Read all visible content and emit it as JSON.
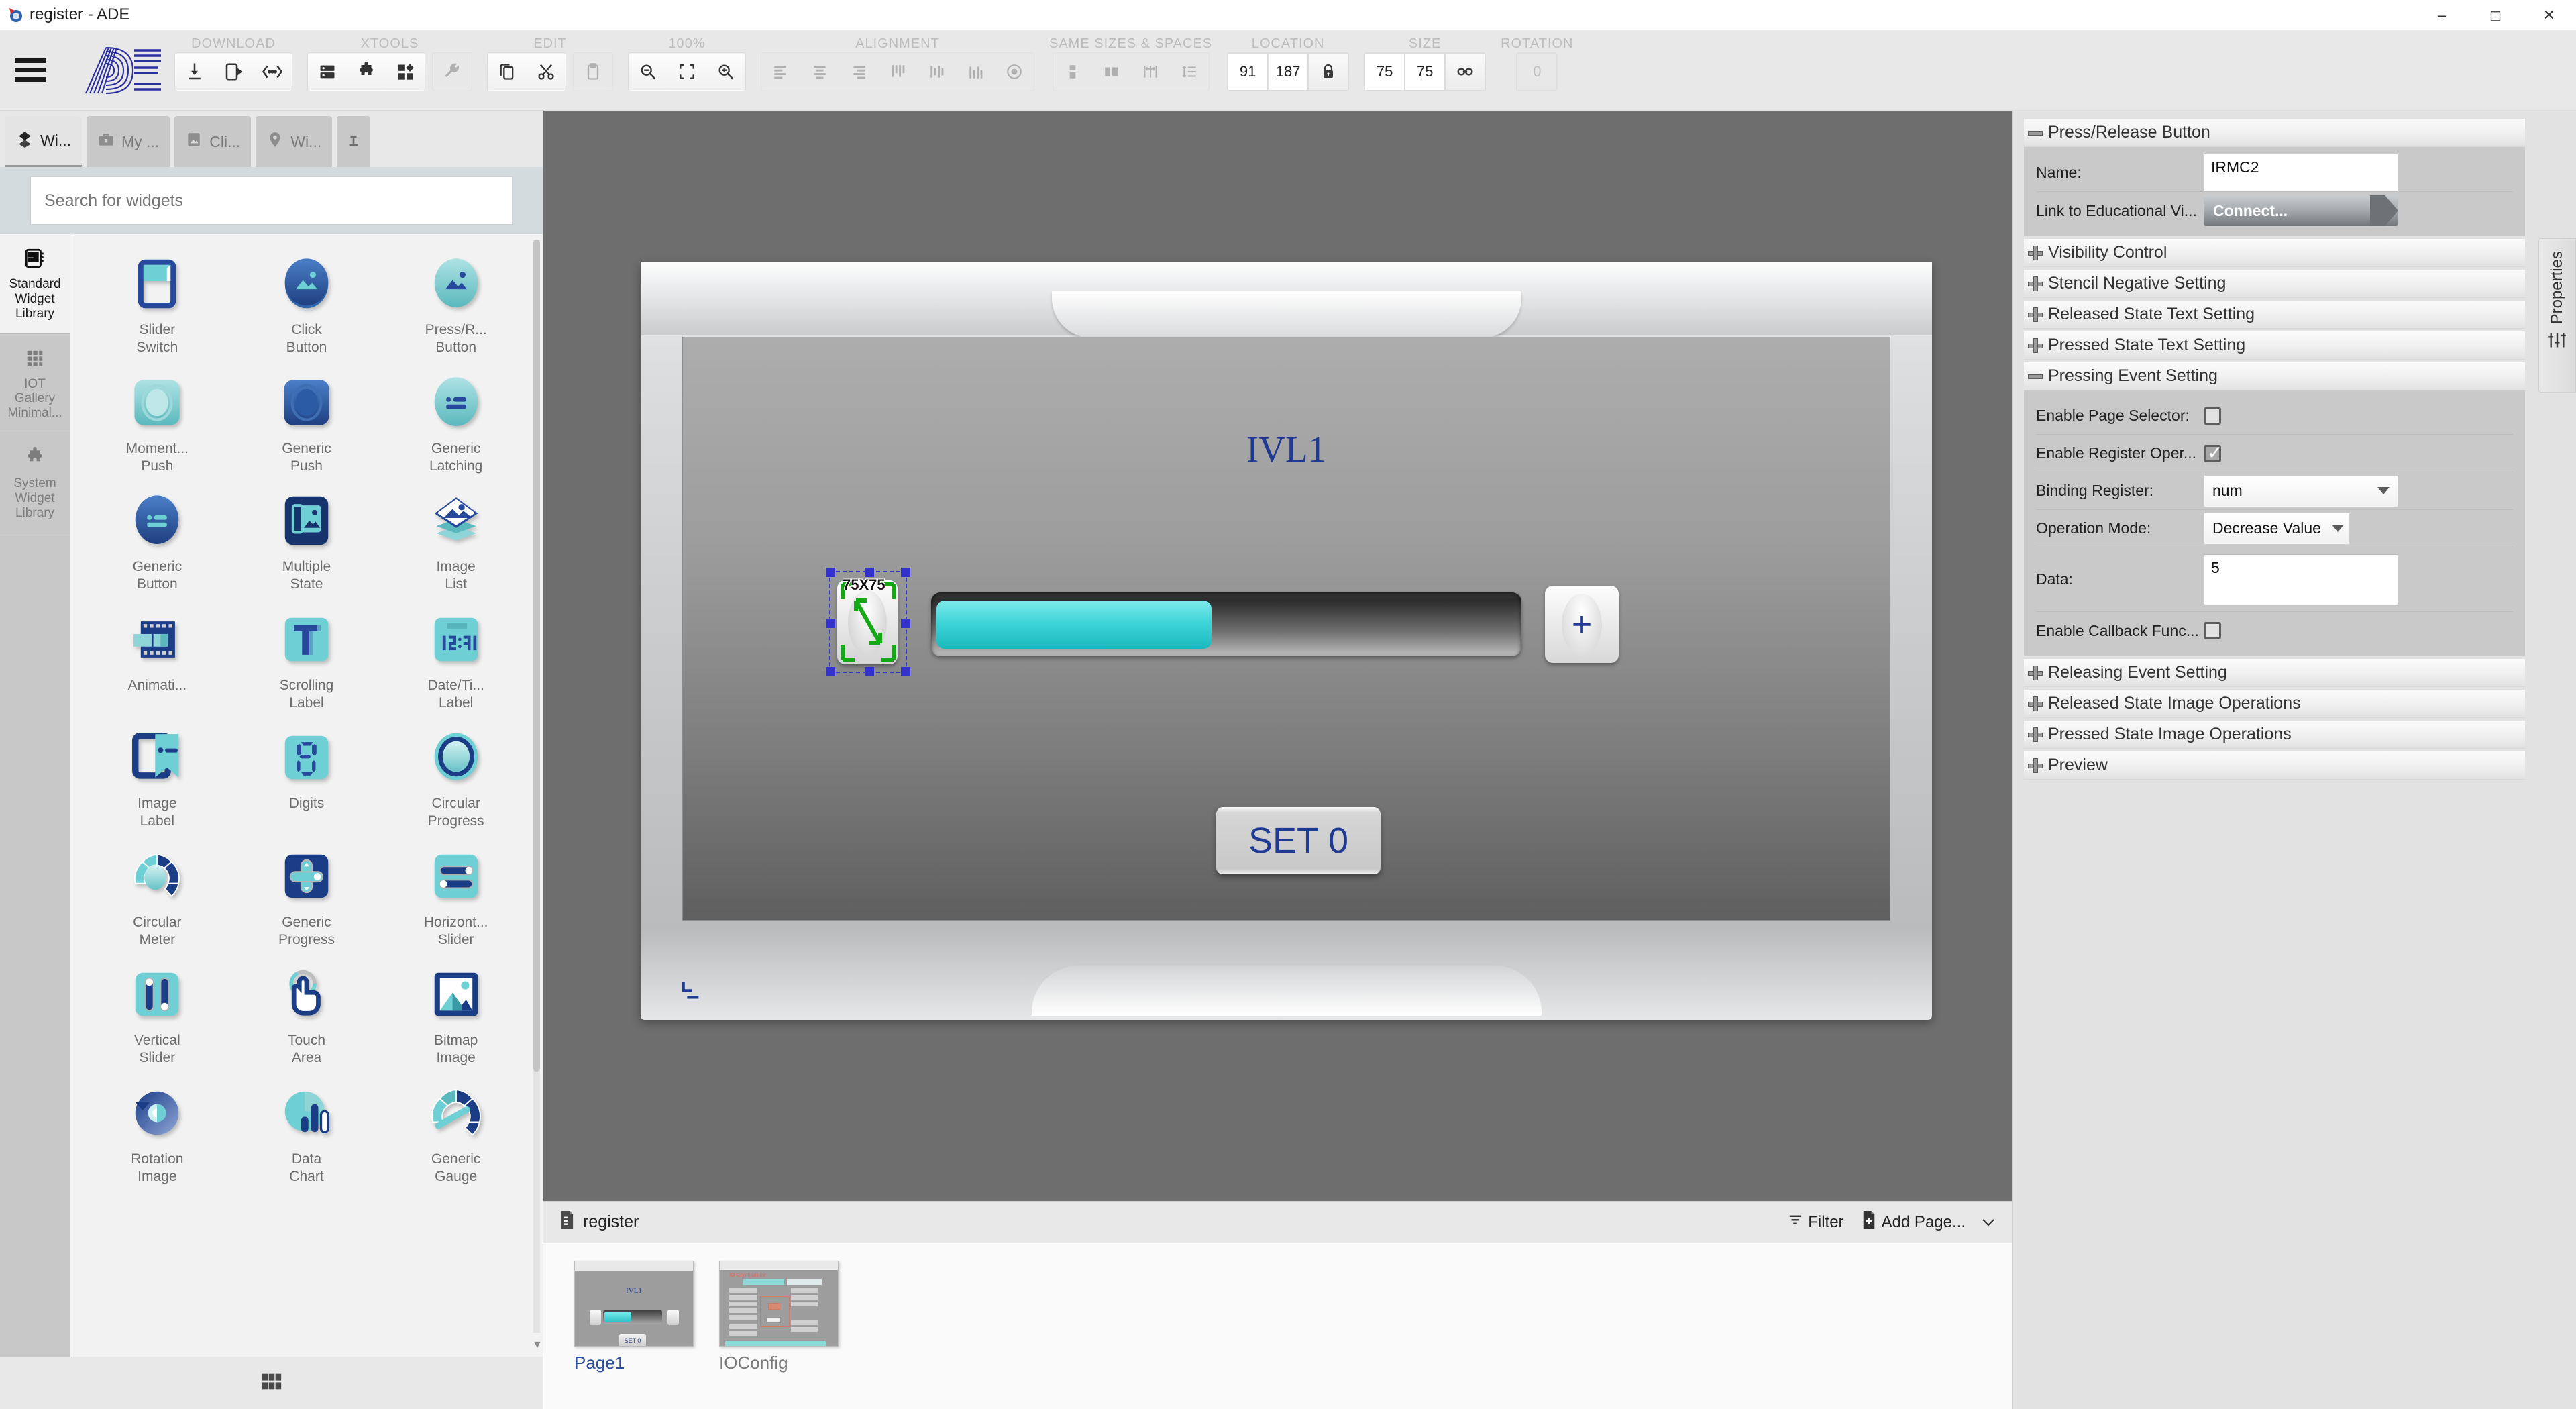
{
  "window": {
    "title": "register - ADE",
    "icon": "app-icon",
    "controls": [
      "minimize",
      "maximize",
      "close"
    ]
  },
  "ribbon": {
    "logo_text": "ADE",
    "groups": [
      {
        "label": "DOWNLOAD",
        "buttons": [
          {
            "name": "download-icon",
            "enabled": true
          },
          {
            "name": "export-device-icon",
            "enabled": true
          },
          {
            "name": "code-brackets-icon",
            "enabled": true
          }
        ]
      },
      {
        "label": "XTOOLS",
        "buttons": [
          {
            "name": "server-icon",
            "enabled": true
          },
          {
            "name": "puzzle-icon",
            "enabled": true
          },
          {
            "name": "components-icon",
            "enabled": true
          },
          {
            "name": "wrench-icon",
            "enabled": false
          }
        ]
      },
      {
        "label": "EDIT",
        "buttons": [
          {
            "name": "copy-icon",
            "enabled": true
          },
          {
            "name": "cut-icon",
            "enabled": true
          },
          {
            "name": "paste-icon",
            "enabled": false
          }
        ]
      },
      {
        "label": "100%",
        "buttons": [
          {
            "name": "zoom-out-icon",
            "enabled": true
          },
          {
            "name": "fit-screen-icon",
            "enabled": true
          },
          {
            "name": "zoom-in-icon",
            "enabled": true
          }
        ]
      },
      {
        "label": "ALIGNMENT",
        "buttons": [
          {
            "name": "align-left-icon",
            "enabled": false
          },
          {
            "name": "align-center-icon",
            "enabled": false
          },
          {
            "name": "align-right-icon",
            "enabled": false
          },
          {
            "name": "align-top-icon",
            "enabled": false
          },
          {
            "name": "align-middle-icon",
            "enabled": false
          },
          {
            "name": "align-bottom-icon",
            "enabled": false
          },
          {
            "name": "align-center-page-icon",
            "enabled": false
          }
        ]
      },
      {
        "label": "SAME SIZES & SPACES",
        "buttons": [
          {
            "name": "same-height-icon",
            "enabled": false
          },
          {
            "name": "same-width-icon",
            "enabled": false
          },
          {
            "name": "space-horizontal-icon",
            "enabled": false
          },
          {
            "name": "space-vertical-icon",
            "enabled": false
          }
        ]
      }
    ],
    "location": {
      "label": "LOCATION",
      "x": "91",
      "y": "187",
      "lock_icon": "lock-icon"
    },
    "size": {
      "label": "SIZE",
      "w": "75",
      "h": "75",
      "link_icon": "link-icon"
    },
    "rotation": {
      "label": "ROTATION",
      "value": "0"
    }
  },
  "left_panel": {
    "tabs": [
      {
        "label": "Wi...",
        "icon": "widgets-icon",
        "active": true
      },
      {
        "label": "My ...",
        "icon": "briefcase-icon",
        "active": false
      },
      {
        "label": "Cli...",
        "icon": "image-icon",
        "active": false
      },
      {
        "label": "Wi...",
        "icon": "pin-location-icon",
        "active": false
      }
    ],
    "pin_icon": "pin-icon",
    "search": {
      "placeholder": "Search for widgets",
      "value": ""
    },
    "libraries": [
      {
        "label": "Standard Widget Library",
        "icon": "library-book-icon",
        "active": true
      },
      {
        "label": "IOT Gallery Minimal...",
        "icon": "grid-dots-icon",
        "active": false
      },
      {
        "label": "System Widget Library",
        "icon": "puzzle-icon",
        "active": false
      }
    ],
    "widgets": [
      {
        "label": "Slider\nSwitch",
        "icon": "slider-switch-icon"
      },
      {
        "label": "Click\nButton",
        "icon": "click-button-icon"
      },
      {
        "label": "Press/R...\nButton",
        "icon": "press-release-button-icon"
      },
      {
        "label": "Moment...\nPush",
        "icon": "momentary-push-icon"
      },
      {
        "label": "Generic\nPush",
        "icon": "generic-push-icon"
      },
      {
        "label": "Generic\nLatching",
        "icon": "generic-latching-icon"
      },
      {
        "label": "Generic\nButton",
        "icon": "generic-button-icon"
      },
      {
        "label": "Multiple\nState",
        "icon": "multiple-state-icon"
      },
      {
        "label": "Image\nList",
        "icon": "image-list-icon"
      },
      {
        "label": "Animati...",
        "icon": "animation-icon"
      },
      {
        "label": "Scrolling\nLabel",
        "icon": "scrolling-label-icon"
      },
      {
        "label": "Date/Ti...\nLabel",
        "icon": "datetime-label-icon"
      },
      {
        "label": "Image\nLabel",
        "icon": "image-label-icon"
      },
      {
        "label": "Digits",
        "icon": "digits-icon"
      },
      {
        "label": "Circular\nProgress",
        "icon": "circular-progress-icon"
      },
      {
        "label": "Circular\nMeter",
        "icon": "circular-meter-icon"
      },
      {
        "label": "Generic\nProgress",
        "icon": "generic-progress-icon"
      },
      {
        "label": "Horizont...\nSlider",
        "icon": "horizontal-slider-icon"
      },
      {
        "label": "Vertical\nSlider",
        "icon": "vertical-slider-icon"
      },
      {
        "label": "Touch\nArea",
        "icon": "touch-area-icon"
      },
      {
        "label": "Bitmap\nImage",
        "icon": "bitmap-image-icon"
      },
      {
        "label": "Rotation\nImage",
        "icon": "rotation-image-icon"
      },
      {
        "label": "Data\nChart",
        "icon": "data-chart-icon"
      },
      {
        "label": "Generic\nGauge",
        "icon": "generic-gauge-icon"
      }
    ],
    "footer_icon": "grid-apps-icon"
  },
  "canvas": {
    "screen_title": "IVL1",
    "selection_size_badge": "75X75",
    "set_button_label": "SET 0",
    "plus_button_label": "+"
  },
  "pages_panel": {
    "document_name": "register",
    "document_icon": "file-icon",
    "filter_label": "Filter",
    "filter_icon": "filter-icon",
    "add_page_label": "Add Page...",
    "add_page_icon": "add-page-icon",
    "more_icon": "chevron-down-icon",
    "pages": [
      {
        "name": "Page1",
        "selected": true
      },
      {
        "name": "IOConfig",
        "selected": false
      }
    ]
  },
  "properties": {
    "side_tab_label": "Properties",
    "side_tab_icon": "sliders-icon",
    "sections": [
      {
        "title": "Press/Release Button",
        "expanded": true,
        "rows": [
          {
            "label": "Name:",
            "type": "text",
            "value": "IRMC2"
          },
          {
            "label": "Link to Educational Vi...",
            "type": "button",
            "value": "Connect..."
          }
        ]
      },
      {
        "title": "Visibility Control",
        "expanded": false,
        "rows": []
      },
      {
        "title": "Stencil Negative Setting",
        "expanded": false,
        "rows": []
      },
      {
        "title": "Released State Text Setting",
        "expanded": false,
        "rows": []
      },
      {
        "title": "Pressed State Text Setting",
        "expanded": false,
        "rows": []
      },
      {
        "title": "Pressing Event Setting",
        "expanded": true,
        "rows": [
          {
            "label": "Enable Page Selector:",
            "type": "checkbox",
            "checked": false
          },
          {
            "label": "Enable Register Oper...",
            "type": "checkbox",
            "checked": true
          },
          {
            "label": "Binding Register:",
            "type": "select-wide",
            "value": "num"
          },
          {
            "label": "Operation Mode:",
            "type": "select",
            "value": "Decrease Value"
          },
          {
            "label": "Data:",
            "type": "text",
            "value": "5"
          },
          {
            "label": "Enable Callback Func...",
            "type": "checkbox",
            "checked": false
          }
        ]
      },
      {
        "title": "Releasing Event Setting",
        "expanded": false,
        "rows": []
      },
      {
        "title": "Released State Image Operations",
        "expanded": false,
        "rows": []
      },
      {
        "title": "Pressed State Image Operations",
        "expanded": false,
        "rows": []
      },
      {
        "title": "Preview",
        "expanded": false,
        "rows": []
      }
    ]
  },
  "colors": {
    "accent_blue": "#1f3a93",
    "teal": "#3fd5d8",
    "selection": "#3333cc",
    "selection_green": "#14a814",
    "panel_bg": "#e2e2e2",
    "canvas_bg": "#6e6e6e"
  }
}
